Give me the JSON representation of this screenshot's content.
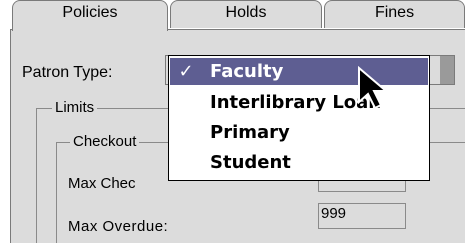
{
  "tabs": [
    {
      "label": "Policies",
      "active": true
    },
    {
      "label": "Holds",
      "active": false
    },
    {
      "label": "Fines",
      "active": false
    }
  ],
  "patron_type": {
    "label": "Patron Type:",
    "selected": "Faculty",
    "options": [
      {
        "label": "Faculty",
        "checked": true
      },
      {
        "label": "Interlibrary Loan",
        "checked": false
      },
      {
        "label": "Primary",
        "checked": false
      },
      {
        "label": "Student",
        "checked": false
      }
    ],
    "check_glyph": "✓"
  },
  "limits": {
    "title": "Limits",
    "checkout": {
      "title": "Checkout",
      "max_checkouts_label": "Max Chec",
      "max_checkouts_value": "",
      "max_overdue_label": "Max Overdue:",
      "max_overdue_value": "999"
    }
  },
  "colors": {
    "panel_bg": "#dcdcdc",
    "selection_bg": "#5e5e92",
    "selection_fg": "#ffffff"
  },
  "icons": {
    "cursor": "mouse-pointer-icon",
    "check": "checkmark-icon"
  }
}
